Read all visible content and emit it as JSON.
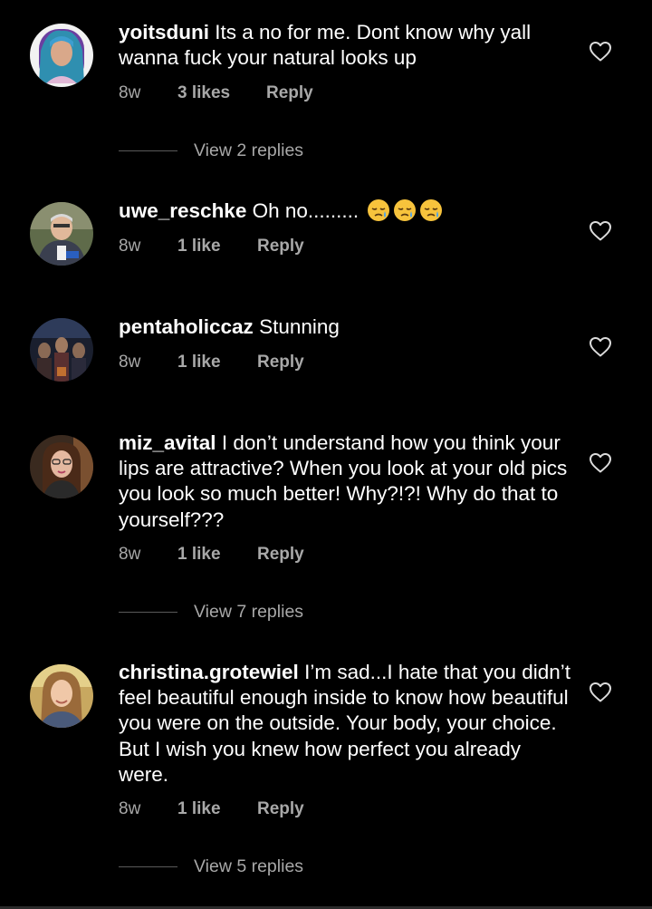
{
  "comments": [
    {
      "username": "yoitsduni",
      "text": "Its a no for me. Dont know why yall wanna fuck your natural looks up",
      "time": "8w",
      "likes": "3 likes",
      "reply": "Reply",
      "view_replies": "View 2 replies"
    },
    {
      "username": "uwe_reschke",
      "text": "Oh no.........",
      "time": "8w",
      "likes": "1 like",
      "reply": "Reply"
    },
    {
      "username": "pentaholiccaz",
      "text": "Stunning",
      "time": "8w",
      "likes": "1 like",
      "reply": "Reply"
    },
    {
      "username": "miz_avital",
      "text": "I don’t understand how you think your lips are attractive? When you look at your old pics you look so much better! Why?!?! Why do that to yourself???",
      "time": "8w",
      "likes": "1 like",
      "reply": "Reply",
      "view_replies": "View 7 replies"
    },
    {
      "username": "christina.grotewiel",
      "text": "I’m sad...I hate that you didn’t feel beautiful enough inside to know how beautiful you were on the outside. Your body, your choice. But I wish you knew how perfect you already were.",
      "time": "8w",
      "likes": "1 like",
      "reply": "Reply",
      "view_replies": "View 5 replies"
    }
  ],
  "icons": {
    "like": "heart-outline-icon",
    "emoji": "sleepy-face-emoji"
  },
  "colors": {
    "background": "#000000",
    "text": "#ffffff",
    "secondary": "#a8a8a8",
    "divider": "#5a5a5a"
  }
}
